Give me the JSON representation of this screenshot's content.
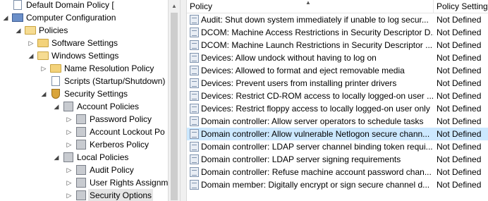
{
  "tree": {
    "items": [
      {
        "label": "Default Domain Policy [",
        "expander": "",
        "icon": "policy-doc-icon"
      },
      {
        "label": "Computer Configuration",
        "expander": "◢",
        "icon": "computer-icon"
      },
      {
        "label": "Policies",
        "expander": "◢",
        "icon": "folder-open-icon"
      },
      {
        "label": "Software Settings",
        "expander": "▷",
        "icon": "folder-icon"
      },
      {
        "label": "Windows Settings",
        "expander": "◢",
        "icon": "folder-open-icon"
      },
      {
        "label": "Name Resolution Policy",
        "expander": "▷",
        "icon": "folder-icon"
      },
      {
        "label": "Scripts (Startup/Shutdown)",
        "expander": "",
        "icon": "script-doc-icon"
      },
      {
        "label": "Security Settings",
        "expander": "◢",
        "icon": "security-shield-icon"
      },
      {
        "label": "Account Policies",
        "expander": "◢",
        "icon": "policy-book-icon"
      },
      {
        "label": "Password Policy",
        "expander": "▷",
        "icon": "policy-book-icon"
      },
      {
        "label": "Account Lockout Po",
        "expander": "▷",
        "icon": "policy-book-icon"
      },
      {
        "label": "Kerberos Policy",
        "expander": "▷",
        "icon": "policy-book-icon"
      },
      {
        "label": "Local Policies",
        "expander": "◢",
        "icon": "policy-book-icon"
      },
      {
        "label": "Audit Policy",
        "expander": "▷",
        "icon": "policy-book-icon"
      },
      {
        "label": "User Rights Assignm",
        "expander": "▷",
        "icon": "policy-book-icon"
      },
      {
        "label": "Security Options",
        "expander": "▷",
        "icon": "policy-book-icon"
      }
    ]
  },
  "list": {
    "columns": {
      "policy": "Policy",
      "setting": "Policy Setting"
    },
    "sort_indicator": "▲",
    "rows": [
      {
        "name": "Audit: Shut down system immediately if unable to log secur...",
        "setting": "Not Defined"
      },
      {
        "name": "DCOM: Machine Access Restrictions in Security Descriptor D...",
        "setting": "Not Defined"
      },
      {
        "name": "DCOM: Machine Launch Restrictions in Security Descriptor ...",
        "setting": "Not Defined"
      },
      {
        "name": "Devices: Allow undock without having to log on",
        "setting": "Not Defined"
      },
      {
        "name": "Devices: Allowed to format and eject removable media",
        "setting": "Not Defined"
      },
      {
        "name": "Devices: Prevent users from installing printer drivers",
        "setting": "Not Defined"
      },
      {
        "name": "Devices: Restrict CD-ROM access to locally logged-on user ...",
        "setting": "Not Defined"
      },
      {
        "name": "Devices: Restrict floppy access to locally logged-on user only",
        "setting": "Not Defined"
      },
      {
        "name": "Domain controller: Allow server operators to schedule tasks",
        "setting": "Not Defined"
      },
      {
        "name": "Domain controller: Allow vulnerable Netlogon secure chann...",
        "setting": "Not Defined"
      },
      {
        "name": "Domain controller: LDAP server channel binding token requi...",
        "setting": "Not Defined"
      },
      {
        "name": "Domain controller: LDAP server signing requirements",
        "setting": "Not Defined"
      },
      {
        "name": "Domain controller: Refuse machine account password chan...",
        "setting": "Not Defined"
      },
      {
        "name": "Domain member: Digitally encrypt or sign secure channel d...",
        "setting": "Not Defined"
      }
    ]
  },
  "scrollbar": {
    "up_arrow": "▲"
  }
}
